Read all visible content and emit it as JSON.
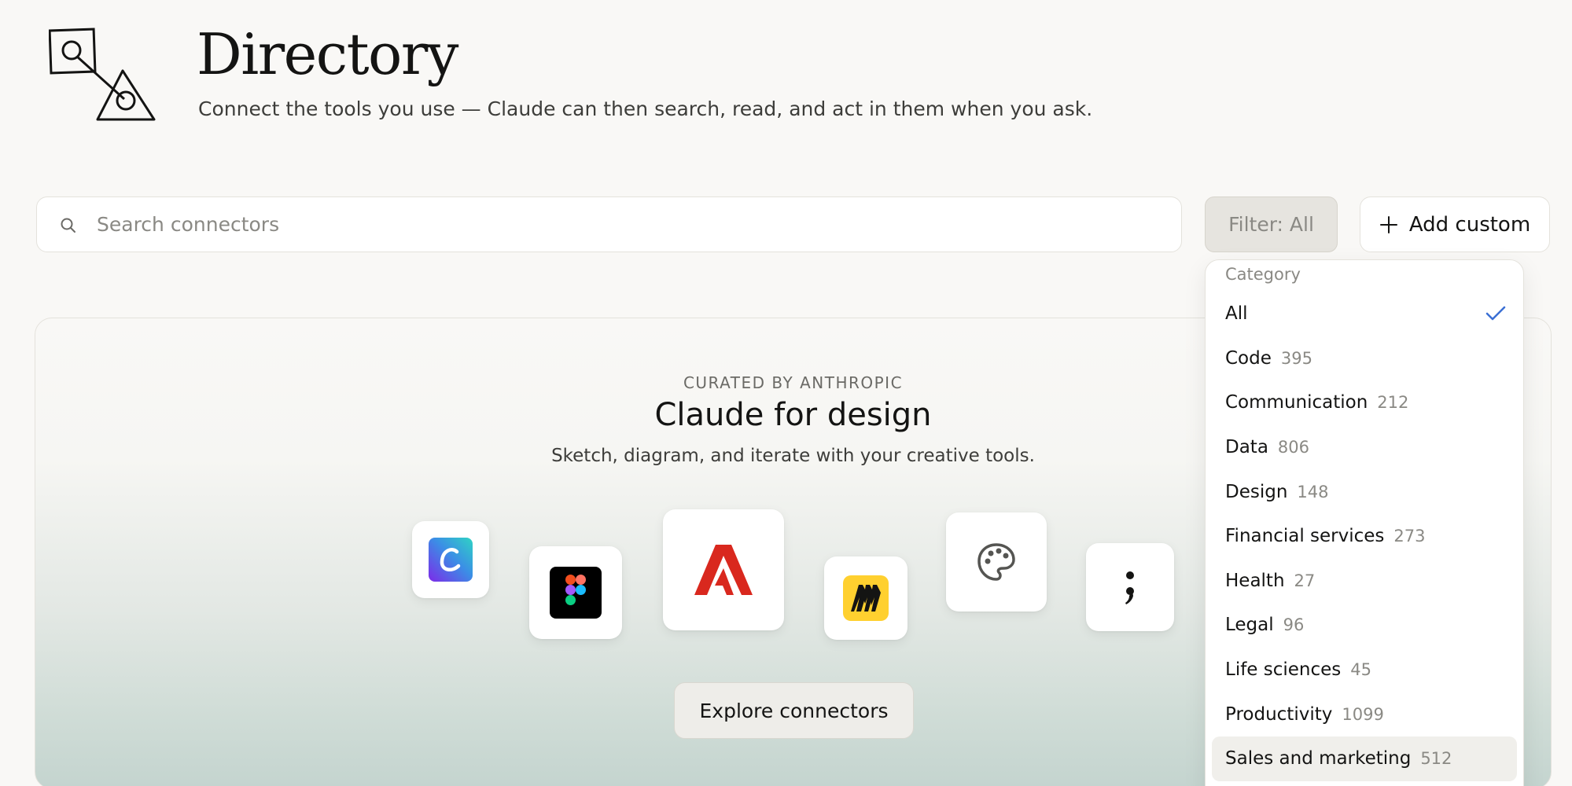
{
  "header": {
    "title": "Directory",
    "subtitle": "Connect the tools you use — Claude can then search, read, and act in them when you ask."
  },
  "toolbar": {
    "search_placeholder": "Search connectors",
    "filter_label": "Filter: All",
    "add_label": "Add custom"
  },
  "featured": {
    "eyebrow": "CURATED BY ANTHROPIC",
    "title": "Claude for design",
    "subtitle": "Sketch, diagram, and iterate with your creative tools.",
    "apps": [
      "canva-icon",
      "figma-icon",
      "adobe-icon",
      "miro-icon",
      "palette-icon",
      "semicolon-icon"
    ],
    "explore_label": "Explore connectors"
  },
  "dropdown": {
    "heading": "Category",
    "selected": "All",
    "items": [
      {
        "label": "All",
        "count": ""
      },
      {
        "label": "Code",
        "count": "395"
      },
      {
        "label": "Communication",
        "count": "212"
      },
      {
        "label": "Data",
        "count": "806"
      },
      {
        "label": "Design",
        "count": "148"
      },
      {
        "label": "Financial services",
        "count": "273"
      },
      {
        "label": "Health",
        "count": "27"
      },
      {
        "label": "Legal",
        "count": "96"
      },
      {
        "label": "Life sciences",
        "count": "45"
      },
      {
        "label": "Productivity",
        "count": "1099"
      },
      {
        "label": "Sales and marketing",
        "count": "512"
      }
    ]
  },
  "colors": {
    "accent_check": "#3b6fd4",
    "adobe_red": "#d9281e",
    "miro_yellow": "#ffd02f",
    "figma_tile": "#000000"
  }
}
